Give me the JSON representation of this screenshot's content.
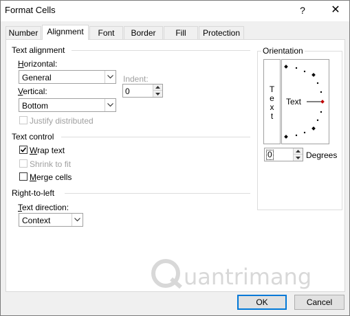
{
  "window": {
    "title": "Format Cells",
    "help_glyph": "?",
    "close_glyph": "✕"
  },
  "tabs": [
    {
      "label": "Number"
    },
    {
      "label": "Alignment"
    },
    {
      "label": "Font"
    },
    {
      "label": "Border"
    },
    {
      "label": "Fill"
    },
    {
      "label": "Protection"
    }
  ],
  "text_alignment": {
    "group_label": "Text alignment",
    "horizontal_label": "Horizontal:",
    "horizontal_value": "General",
    "vertical_label": "Vertical:",
    "vertical_value": "Bottom",
    "indent_label": "Indent:",
    "indent_value": "0",
    "justify_distributed_label": "Justify distributed"
  },
  "text_control": {
    "group_label": "Text control",
    "wrap_text_label": "Wrap text",
    "wrap_text_checked": true,
    "shrink_to_fit_label": "Shrink to fit",
    "merge_cells_label": "Merge cells"
  },
  "rtl": {
    "group_label": "Right-to-left",
    "text_direction_label": "Text direction:",
    "text_direction_value": "Context"
  },
  "orientation": {
    "group_label": "Orientation",
    "vertical_text": [
      "T",
      "e",
      "x",
      "t"
    ],
    "dial_text": "Text",
    "degrees_value": "0",
    "degrees_label": "Degrees"
  },
  "watermark": {
    "text": "uantrimang"
  },
  "buttons": {
    "ok": "OK",
    "cancel": "Cancel"
  }
}
